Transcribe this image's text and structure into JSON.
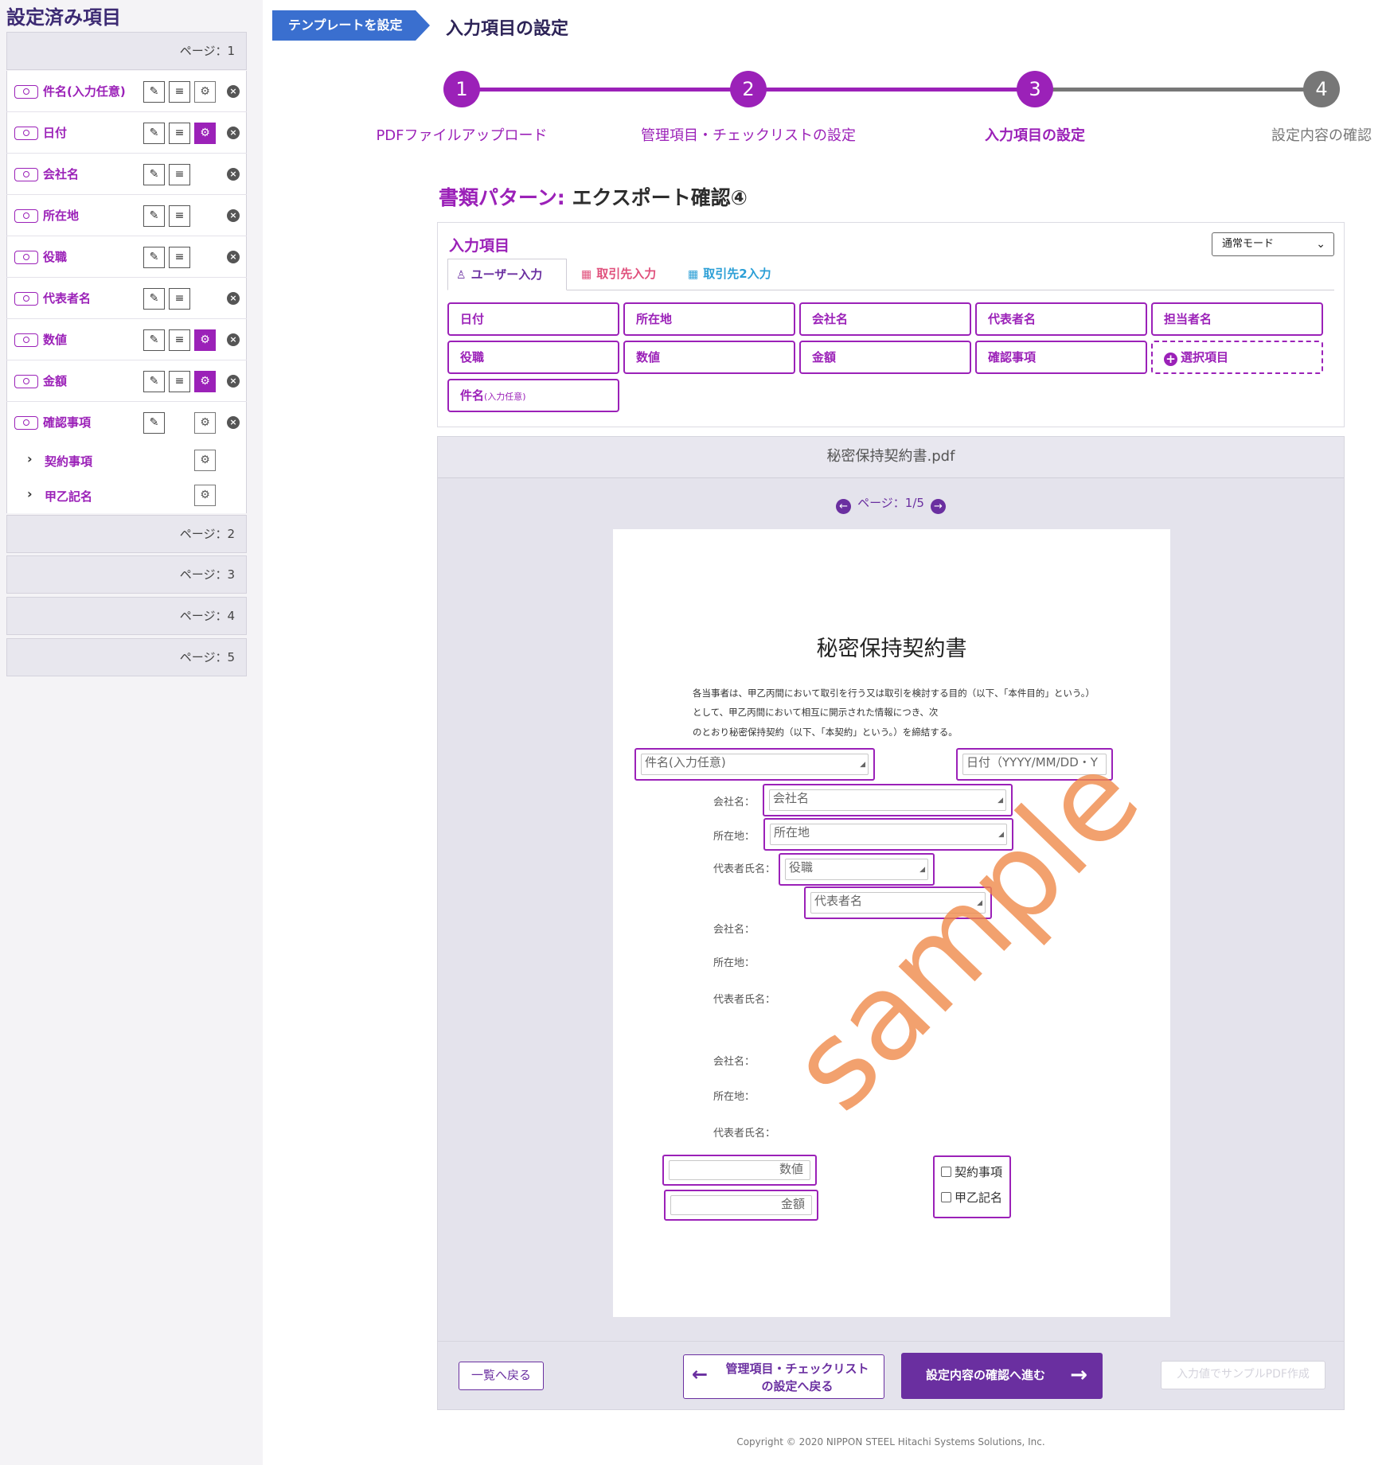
{
  "sidebar": {
    "title": "設定済み項目",
    "pages": [
      "ページ：1",
      "ページ：2",
      "ページ：3",
      "ページ：4",
      "ページ：5"
    ],
    "items": [
      {
        "label": "件名(入力任意)",
        "gear_active": false
      },
      {
        "label": "日付",
        "gear_active": true
      },
      {
        "label": "会社名"
      },
      {
        "label": "所在地"
      },
      {
        "label": "役職"
      },
      {
        "label": "代表者名"
      },
      {
        "label": "数値",
        "gear_active": true
      },
      {
        "label": "金額",
        "gear_active": true
      },
      {
        "label": "確認事項",
        "gear_active": false
      }
    ],
    "subitems": [
      {
        "label": "契約事項"
      },
      {
        "label": "甲乙記名"
      }
    ]
  },
  "header": {
    "breadcrumb": "テンプレートを設定",
    "title": "入力項目の設定"
  },
  "stepper": {
    "steps": [
      {
        "num": "1",
        "label": "PDFファイルアップロード",
        "state": "done"
      },
      {
        "num": "2",
        "label": "管理項目・チェックリストの設定",
        "state": "done"
      },
      {
        "num": "3",
        "label": "入力項目の設定",
        "state": "current"
      },
      {
        "num": "4",
        "label": "設定内容の確認",
        "state": "todo"
      }
    ]
  },
  "pattern": {
    "prefix": "書類パターン:",
    "name": "エクスポート確認④"
  },
  "items_panel": {
    "title": "入力項目",
    "mode": "通常モード",
    "tabs": [
      {
        "label": "ユーザー入力",
        "icon": "user-icon",
        "color": "#6a2fa0"
      },
      {
        "label": "取引先入力",
        "icon": "building-icon",
        "color": "#e0507c"
      },
      {
        "label": "取引先2入力",
        "icon": "building-icon",
        "color": "#2c9fd6"
      }
    ],
    "fields": [
      "日付",
      "所在地",
      "会社名",
      "代表者名",
      "担当者名",
      "役職",
      "数値",
      "金額",
      "確認事項",
      "選択項目",
      "件名",
      "(入力任意)"
    ]
  },
  "viewer": {
    "filename": "秘密保持契約書.pdf",
    "page_indicator": "ページ：1/5",
    "doc": {
      "title": "秘密保持契約書",
      "para1": "各当事者は、甲乙丙間において取引を行う又は取引を検討する目的（以下、「本件目的」という。）",
      "para2": "として、甲乙丙間において相互に開示された情報につき、次",
      "para3": "のとおり秘密保持契約（以下、「本契約」という。）を締結する。",
      "lbl_company": "会社名：",
      "lbl_address": "所在地：",
      "lbl_rep": "代表者氏名：",
      "f_subject": "件名(入力任意)",
      "f_date": "日付（YYYY/MM/DD・Y",
      "f_company": "会社名",
      "f_address": "所在地",
      "f_position": "役職",
      "f_repname": "代表者名",
      "f_number": "数値",
      "f_amount": "金額",
      "chk1": "契約事項",
      "chk2": "甲乙記名",
      "watermark": "sample"
    }
  },
  "footer": {
    "back_list": "一覧へ戻る",
    "back_step_line1": "管理項目・チェックリスト",
    "back_step_line2": "の設定へ戻る",
    "next": "設定内容の確認へ進む",
    "sample_pdf": "入力値でサンプルPDF作成",
    "copyright": "Copyright © 2020 NIPPON STEEL Hitachi Systems Solutions, Inc."
  },
  "colors": {
    "accent": "#9b21b8",
    "primary": "#6a2fa0",
    "breadcrumb": "#3a6fcf",
    "step_todo": "#777777"
  }
}
